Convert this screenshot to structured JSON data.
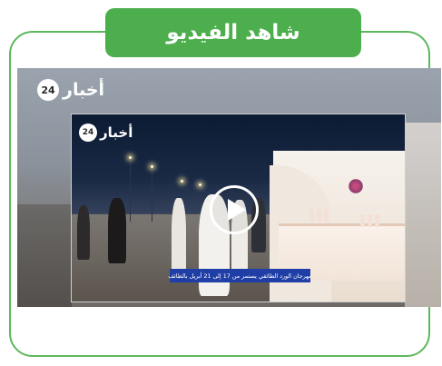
{
  "header": {
    "title": "شاهد الفيديو"
  },
  "brand": {
    "logo_text": "أخبار",
    "logo_badge": "24"
  },
  "video": {
    "caption": "مهرجان الورد الطائفي يستمر من 17 إلى 21 أبريل بالطائف",
    "play_icon": "play-icon"
  },
  "colors": {
    "accent_green": "#4cae4c",
    "border_green": "#5cb85c",
    "caption_blue": "#1f3fa6"
  }
}
